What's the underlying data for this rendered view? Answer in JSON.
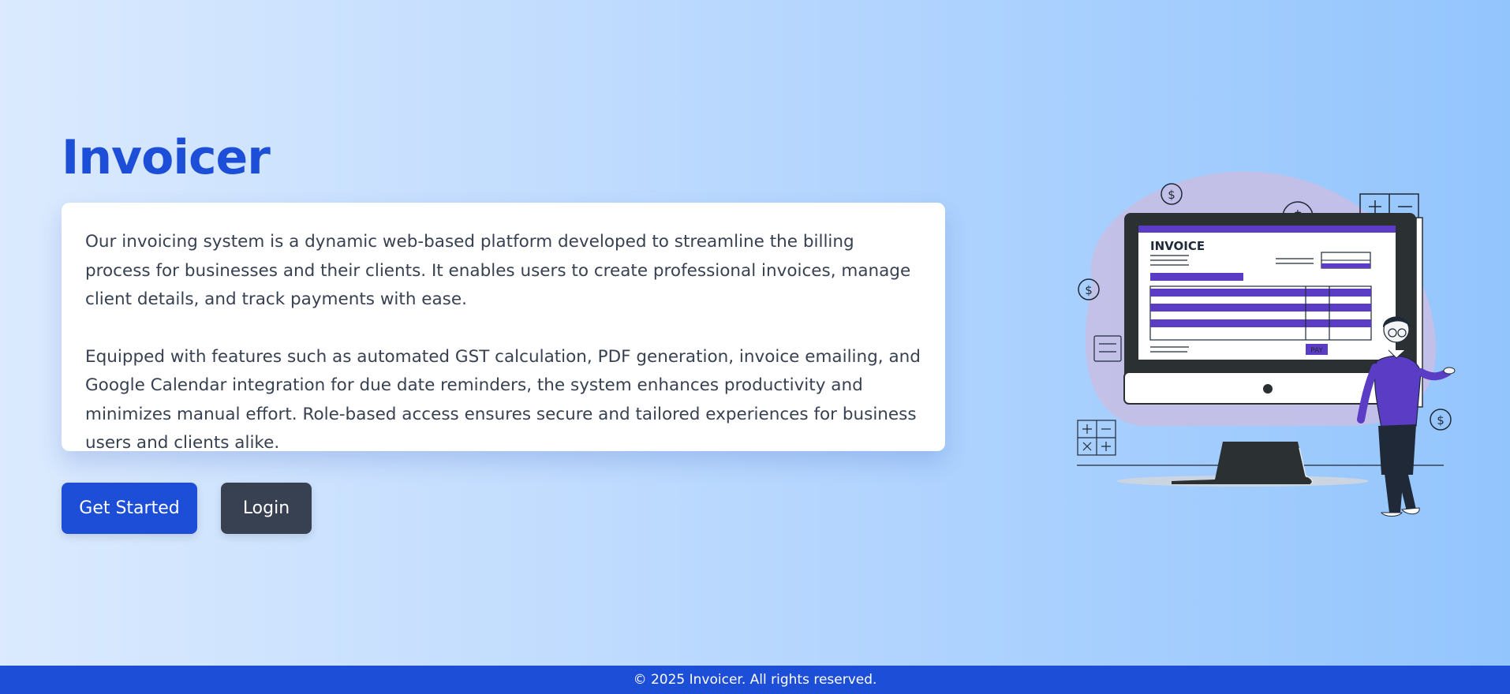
{
  "app": {
    "title": "Invoicer"
  },
  "intro": {
    "paragraph_1": "Our invoicing system is a dynamic web-based platform developed to streamline the billing process for businesses and their clients. It enables users to create professional invoices, manage client details, and track payments with ease.",
    "paragraph_2": "Equipped with features such as automated GST calculation, PDF generation, invoice emailing, and Google Calendar integration for due date reminders, the system enhances productivity and minimizes manual effort. Role-based access ensures secure and tailored experiences for business users and clients alike."
  },
  "actions": {
    "get_started_label": "Get Started",
    "login_label": "Login"
  },
  "illustration": {
    "invoice_heading": "INVOICE",
    "pay_label": "PAY"
  },
  "footer": {
    "copyright": "© 2025 Invoicer. All rights reserved."
  },
  "colors": {
    "brand": "#1d4ed8",
    "secondary_button": "#374151",
    "accent_purple": "#5b3cc4",
    "blob": "#c7bfe6"
  }
}
